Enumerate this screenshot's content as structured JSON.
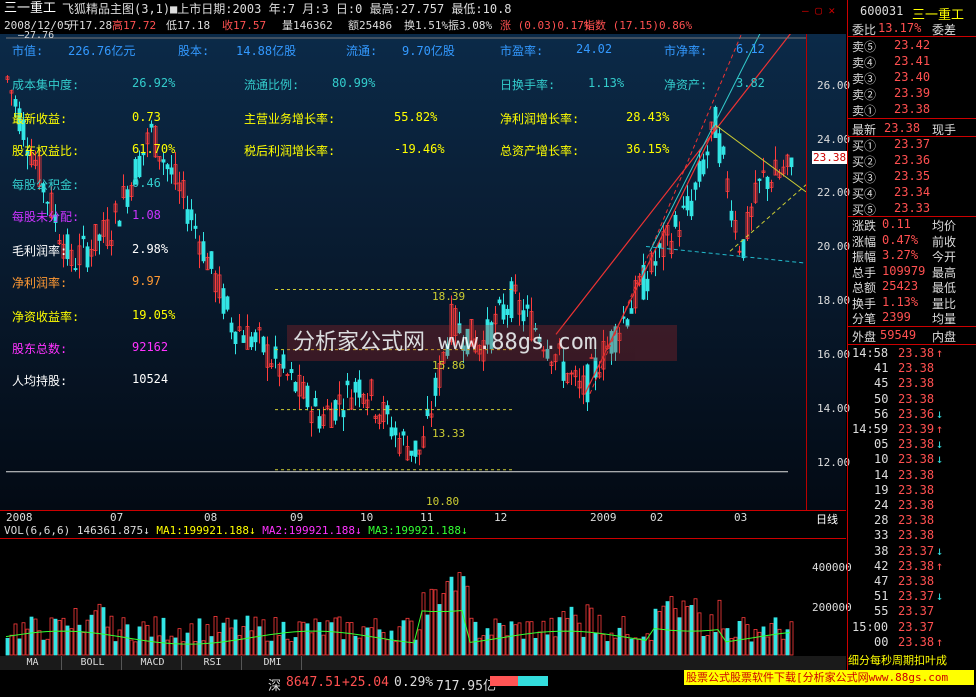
{
  "window": {
    "stock_name": "三一重工",
    "chart_title": "飞狐精品主图(3,1)",
    "list_date": "■上市日期:2003 年:7 月:3 日:0 最高:27.757 最低:10.8",
    "window_buttons": "— ▢ ✕"
  },
  "infobar": {
    "date": "2008/12/05",
    "open": "开17.28",
    "high": "高17.72",
    "low": "低17.18",
    "close": "收17.57",
    "volume": "量146362",
    "amount": "额25486",
    "turnover": "换1.51%",
    "amplitude": "振3.08%",
    "change": "涨 (0.03)0.17%",
    "index": "指数 (17.15)0.86%"
  },
  "fundamentals": {
    "market_cap_label": "市值:",
    "market_cap": "226.76亿元",
    "share_capital_label": "股本:",
    "share_capital": "14.88亿股",
    "float_label": "流通:",
    "float": "9.70亿股",
    "pe_label": "市盈率:",
    "pe": "24.02",
    "pb_label": "市净率:",
    "pb": "6.12",
    "cost_conc_label": "成本集中度:",
    "cost_conc": "26.92%",
    "float_ratio_label": "流通比例:",
    "float_ratio": "80.99%",
    "turnover_label": "日换手率:",
    "turnover": "1.13%",
    "nav_label": "净资产:",
    "nav": "3.82",
    "eps_label": "最新收益:",
    "eps": "0.73",
    "rev_growth_label": "主营业务增长率:",
    "rev_growth": "55.82%",
    "np_growth_label": "净利润增长率:",
    "np_growth": "28.43%",
    "equity_ratio_label": "股东权益比:",
    "equity_ratio": "61.70%",
    "after_tax_growth_label": "税后利润增长率:",
    "after_tax_growth": "-19.46%",
    "asset_growth_label": "总资产增长率:",
    "asset_growth": "36.15%",
    "reserve_label": "每股公积金:",
    "reserve": "0.46",
    "undist_label": "每股未分配:",
    "undist": "1.08",
    "gross_margin_label": "毛利润率:",
    "gross_margin": "2.98%",
    "net_margin_label": "净利润率:",
    "net_margin": "9.97",
    "roe_label": "净资收益率:",
    "roe": "19.05%",
    "holders_label": "股东总数:",
    "holders": "92162",
    "per_holder_label": "人均持股:",
    "per_holder": "10524"
  },
  "chart": {
    "top_marker": "—27.76",
    "y_labels": [
      "26.00",
      "24.00",
      "22.00",
      "20.00",
      "18.00",
      "16.00",
      "14.00",
      "12.00"
    ],
    "current_price_tag": "23.38",
    "fib_levels": [
      "18.39",
      "15.86",
      "13.33",
      "10.80"
    ],
    "date_labels": [
      "2008",
      "07",
      "08",
      "09",
      "10",
      "11",
      "12",
      "2009",
      "02",
      "03"
    ],
    "period": "日线",
    "watermark": "分析家公式网 www.88gs.com"
  },
  "chart_data": {
    "type": "candlestick",
    "title": "飞狐精品主图(3,1)",
    "high": 27.757,
    "low": 10.8,
    "ylim": [
      11,
      27
    ],
    "last_price": 23.38,
    "fib_levels": [
      18.39,
      15.86,
      13.33,
      10.8
    ],
    "x_ticks": [
      "2008",
      "07",
      "08",
      "09",
      "10",
      "11",
      "12",
      "2009",
      "02",
      "03"
    ]
  },
  "volume": {
    "header_vol": "VOL(6,6,6) 146361.875↓",
    "ma1": "MA1:199921.188↓",
    "ma2": "MA2:199921.188↓",
    "ma3": "MA3:199921.188↓",
    "y_labels": [
      "400000",
      "200000"
    ]
  },
  "tabs": [
    "MA",
    "BOLL",
    "MACD",
    "RSI",
    "DMI"
  ],
  "footer": {
    "index_name": "深",
    "index_value": "8647.51",
    "index_change": "+25.04",
    "index_pct": "0.29%",
    "index_amount": "717.95亿",
    "ad_text": "股票公式股票软件下载[分析家公式网www.88gs.com"
  },
  "right_panel": {
    "code": "600031",
    "name": "三一重工",
    "webi_label": "委比",
    "webi": "13.17%",
    "weicha_label": "委差",
    "asks": [
      {
        "label": "卖⑤",
        "price": "23.42"
      },
      {
        "label": "卖④",
        "price": "23.41"
      },
      {
        "label": "卖③",
        "price": "23.40"
      },
      {
        "label": "卖②",
        "price": "23.39"
      },
      {
        "label": "卖①",
        "price": "23.38"
      }
    ],
    "latest_label": "最新",
    "latest": "23.38",
    "cur_hand_label": "现手",
    "bids": [
      {
        "label": "买①",
        "price": "23.37"
      },
      {
        "label": "买②",
        "price": "23.36"
      },
      {
        "label": "买③",
        "price": "23.35"
      },
      {
        "label": "买④",
        "price": "23.34"
      },
      {
        "label": "买⑤",
        "price": "23.33"
      }
    ],
    "stats": [
      {
        "l1": "涨跌",
        "v1": "0.11",
        "l2": "均价"
      },
      {
        "l1": "涨幅",
        "v1": "0.47%",
        "l2": "前收"
      },
      {
        "l1": "振幅",
        "v1": "3.27%",
        "l2": "今开"
      },
      {
        "l1": "总手",
        "v1": "109979",
        "l2": "最高"
      },
      {
        "l1": "总额",
        "v1": "25423",
        "l2": "最低"
      },
      {
        "l1": "换手",
        "v1": "1.13%",
        "l2": "量比"
      },
      {
        "l1": "分笔",
        "v1": "2399",
        "l2": "均量"
      }
    ],
    "outer_label": "外盘",
    "outer": "59549",
    "inner_label": "内盘",
    "ticks": [
      {
        "t": "14:58",
        "p": "23.38",
        "d": "↑"
      },
      {
        "t": "41",
        "p": "23.38",
        "d": ""
      },
      {
        "t": "45",
        "p": "23.38",
        "d": ""
      },
      {
        "t": "50",
        "p": "23.38",
        "d": ""
      },
      {
        "t": "56",
        "p": "23.36",
        "d": "↓"
      },
      {
        "t": "14:59",
        "p": "23.39",
        "d": "↑"
      },
      {
        "t": "05",
        "p": "23.38",
        "d": "↓"
      },
      {
        "t": "10",
        "p": "23.38",
        "d": "↓"
      },
      {
        "t": "14",
        "p": "23.38",
        "d": ""
      },
      {
        "t": "19",
        "p": "23.38",
        "d": ""
      },
      {
        "t": "24",
        "p": "23.38",
        "d": ""
      },
      {
        "t": "28",
        "p": "23.38",
        "d": ""
      },
      {
        "t": "33",
        "p": "23.38",
        "d": ""
      },
      {
        "t": "38",
        "p": "23.37",
        "d": "↓"
      },
      {
        "t": "42",
        "p": "23.38",
        "d": "↑"
      },
      {
        "t": "47",
        "p": "23.38",
        "d": ""
      },
      {
        "t": "51",
        "p": "23.37",
        "d": "↓"
      },
      {
        "t": "55",
        "p": "23.37",
        "d": ""
      },
      {
        "t": "15:00",
        "p": "23.37",
        "d": ""
      },
      {
        "t": "00",
        "p": "23.38",
        "d": "↑"
      }
    ],
    "bottom_text": "细分每秒周期扣叶成"
  },
  "colors": {
    "up": "#ff3c3c",
    "down": "#33e5e5",
    "ma": "#33ff33",
    "bg": "#000000"
  }
}
